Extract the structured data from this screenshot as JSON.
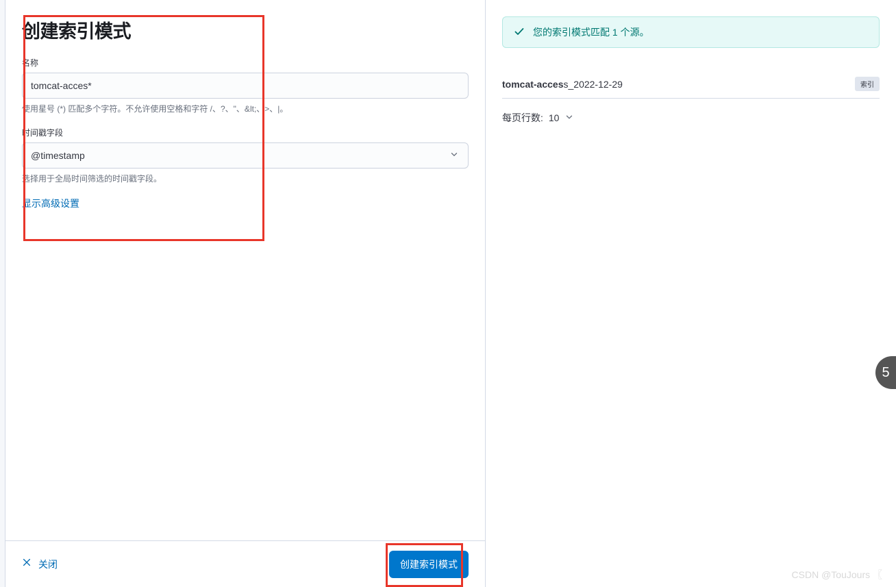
{
  "form": {
    "title": "创建索引模式",
    "nameLabel": "名称",
    "nameValue": "tomcat-acces*",
    "nameHelp": "使用星号 (*) 匹配多个字符。不允许使用空格和字符 /、?、\"、&lt;、>、|。",
    "timestampLabel": "时间戳字段",
    "timestampValue": "@timestamp",
    "timestampHelp": "选择用于全局时间筛选的时间戳字段。",
    "advancedLink": "显示高级设置"
  },
  "footer": {
    "closeLabel": "关闭",
    "submitLabel": "创建索引模式"
  },
  "results": {
    "matchMessage": "您的索引模式匹配 1 个源。",
    "indexBold": "tomcat-acces",
    "indexRest": "s_2022-12-29",
    "badgeLabel": "索引",
    "rowsLabel": "每页行数:",
    "rowsValue": "10"
  },
  "watermark": "CSDN @TouJours 〖",
  "floatBadge": "5"
}
